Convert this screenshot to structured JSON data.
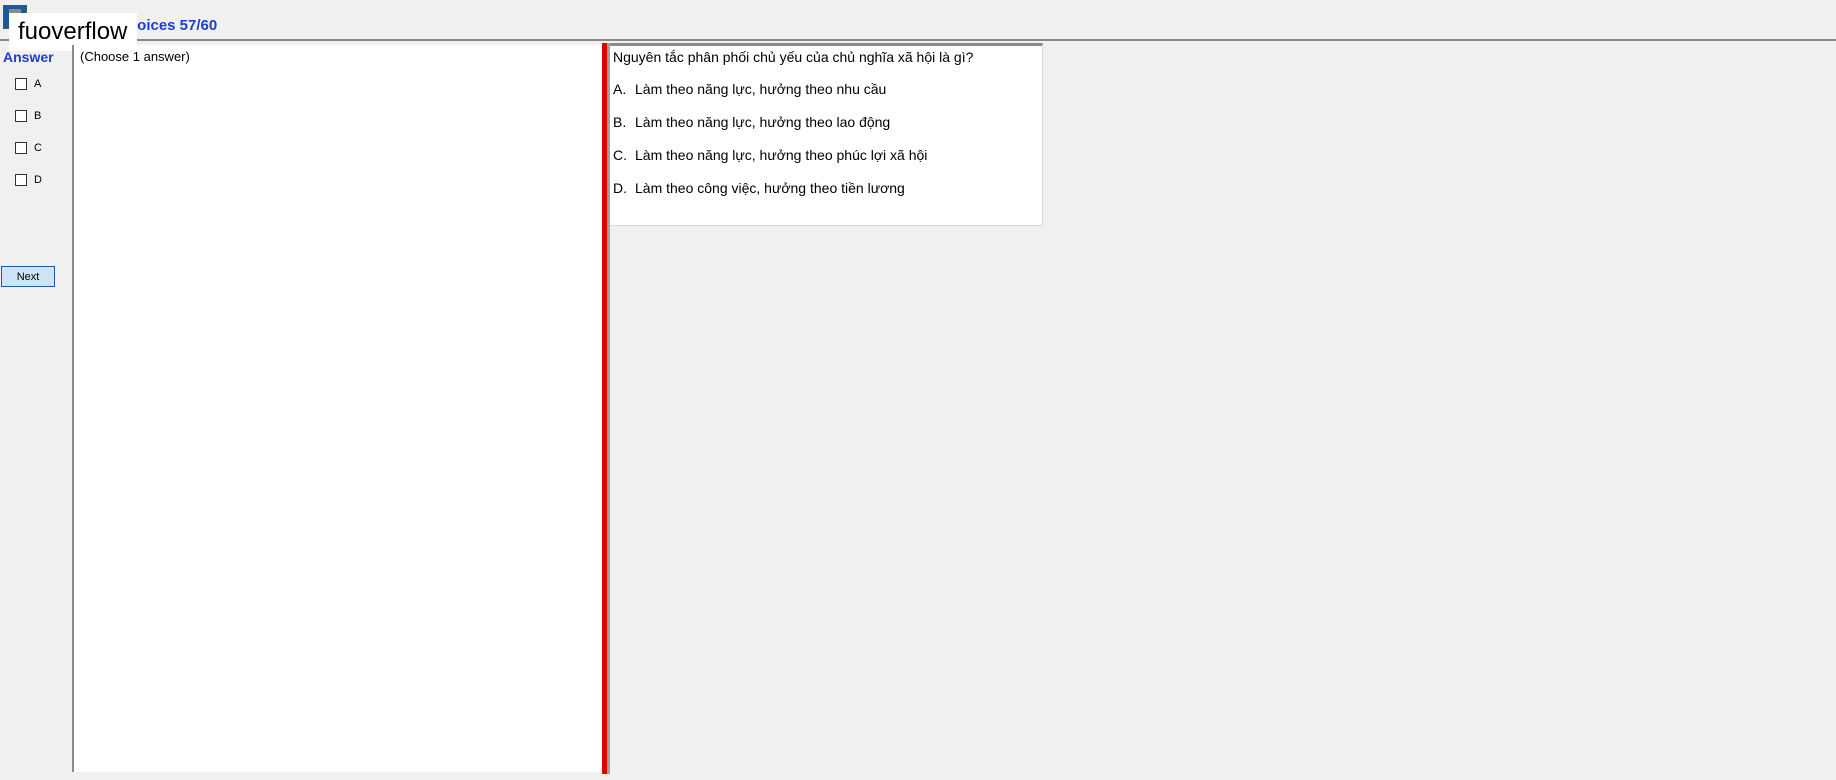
{
  "header": {
    "title": "hoices 57/60",
    "watermark": "fuoverflow"
  },
  "answer_panel": {
    "label": "Answer",
    "choices": [
      {
        "letter": "A",
        "checked": false
      },
      {
        "letter": "B",
        "checked": false
      },
      {
        "letter": "C",
        "checked": false
      },
      {
        "letter": "D",
        "checked": false
      }
    ],
    "next_label": "Next"
  },
  "middle_panel": {
    "hint": "(Choose 1 answer)"
  },
  "question": {
    "text": "Nguyên tắc phân phối chủ yếu của chủ nghĩa xã hội là gì?",
    "options": [
      {
        "letter": "A.",
        "text": "Làm theo năng lực, hưởng theo nhu cầu"
      },
      {
        "letter": "B.",
        "text": "Làm theo năng lực, hưởng theo lao động"
      },
      {
        "letter": "C.",
        "text": "Làm theo năng lực, hưởng theo phúc lợi xã hội"
      },
      {
        "letter": "D.",
        "text": "Làm theo công việc, hưởng theo tiền lương"
      }
    ]
  },
  "colors": {
    "accent_blue": "#1b3fd0",
    "splitter_red": "#e00000",
    "button_fill": "#cde4f7"
  }
}
